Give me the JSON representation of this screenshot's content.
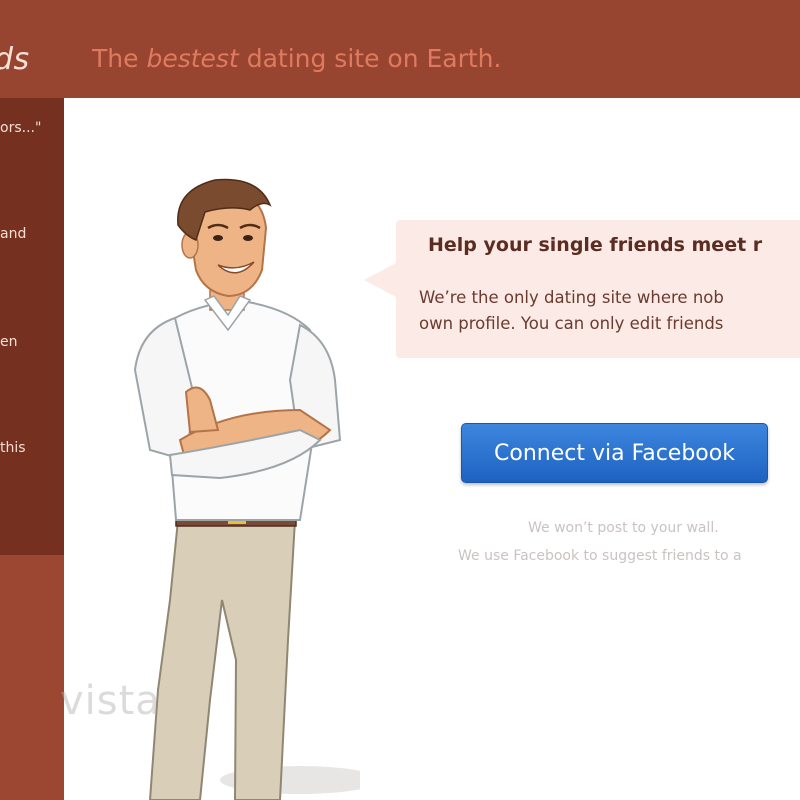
{
  "header": {
    "logo_text": "ds",
    "tagline_prefix": "The ",
    "tagline_emphasis": "bestest",
    "tagline_suffix": " dating site on Earth."
  },
  "sidebar": {
    "items": [
      {
        "label": "ors...\""
      },
      {
        "label": "and"
      },
      {
        "label": "en"
      },
      {
        "label": "this"
      }
    ]
  },
  "main": {
    "bubble_title": "Help your single friends meet r",
    "bubble_line1": "We’re the only dating site where nob",
    "bubble_line2": "own profile. You can only edit friends",
    "connect_button": "Connect via Facebook",
    "note_line1": "We won’t post to your wall.",
    "note_line2": "We use Facebook to suggest friends to a",
    "watermark": "vista"
  },
  "colors": {
    "header_bg": "#974530",
    "sidebar_bg": "#76301f",
    "tagline": "#e07a5f",
    "button": "#2a6fcf",
    "bubble_bg": "#fbeae5"
  },
  "icons": {
    "character": "man-with-crossed-arms-illustration"
  }
}
